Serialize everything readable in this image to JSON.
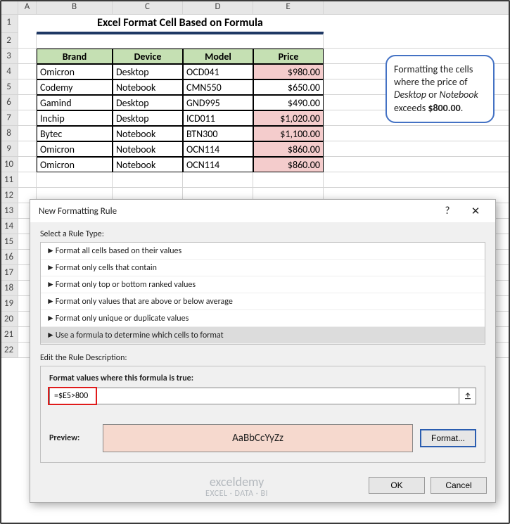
{
  "columns": [
    "A",
    "B",
    "C",
    "D",
    "E"
  ],
  "title": "Excel Format Cell Based on Formula",
  "headers": {
    "brand": "Brand",
    "device": "Device",
    "model": "Model",
    "price": "Price"
  },
  "rows": [
    {
      "brand": "Omicron",
      "device": "Desktop",
      "model": "OCD041",
      "price": "$980.00",
      "hl": true
    },
    {
      "brand": "Codemy",
      "device": "Notebook",
      "model": "CMN550",
      "price": "$650.00",
      "hl": false
    },
    {
      "brand": "Gamind",
      "device": "Desktop",
      "model": "GND995",
      "price": "$490.00",
      "hl": false
    },
    {
      "brand": "Inchip",
      "device": "Desktop",
      "model": "ICD011",
      "price": "$1,020.00",
      "hl": true
    },
    {
      "brand": "Bytec",
      "device": "Notebook",
      "model": "BTN300",
      "price": "$1,100.00",
      "hl": true
    },
    {
      "brand": "Omicron",
      "device": "Notebook",
      "model": "OCN114",
      "price": "$860.00",
      "hl": true
    }
  ],
  "row_numbers": [
    "1",
    "2",
    "3",
    "4",
    "5",
    "6",
    "7",
    "8",
    "9",
    "10",
    "11",
    "12",
    "13",
    "14",
    "15",
    "16",
    "17",
    "18",
    "19",
    "20",
    "21",
    "22"
  ],
  "callout": {
    "pre": "Formatting the cells where the price of ",
    "i1": "Desktop",
    "or": " or ",
    "i2": "Notebook",
    "post": " exceeds ",
    "bold": "$800.00",
    "end": "."
  },
  "dialog": {
    "title": "New Formatting Rule",
    "help": "?",
    "close": "✕",
    "select_label": "Select a Rule Type:",
    "rule_types": [
      "Format all cells based on their values",
      "Format only cells that contain",
      "Format only top or bottom ranked values",
      "Format only values that are above or below average",
      "Format only unique or duplicate values",
      "Use a formula to determine which cells to format"
    ],
    "selected_rule_index": 5,
    "edit_label": "Edit the Rule Description:",
    "formula_label": "Format values where this formula is true:",
    "formula_value": "=$E5>800",
    "preview_label": "Preview:",
    "preview_text": "AaBbCcYyZz",
    "format_btn": "Format...",
    "ok": "OK",
    "cancel": "Cancel"
  },
  "watermark": {
    "big": "exceldemy",
    "small": "EXCEL · DATA · BI"
  }
}
